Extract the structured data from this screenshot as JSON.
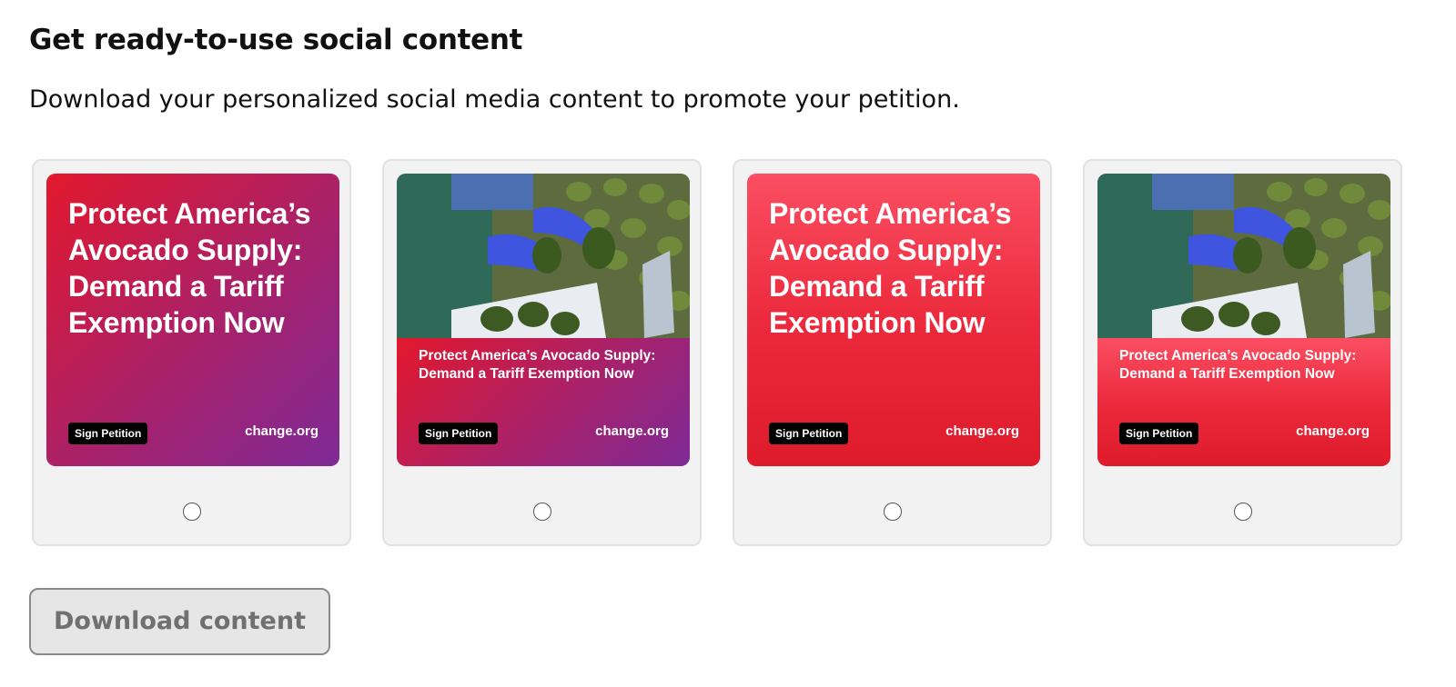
{
  "header": {
    "title": "Get ready-to-use social content",
    "description": "Download your personalized social media content to promote your petition."
  },
  "cards": [
    {
      "style": "text-only",
      "gradient": "purple",
      "title": "Protect America’s Avocado Supply: Demand a Tariff Exemption Now",
      "badge": "Sign Petition",
      "brand": "change.org",
      "selected": false
    },
    {
      "style": "photo",
      "gradient": "purple",
      "image": "gloved hands holding avocados",
      "title": "Protect America’s Avocado Supply: Demand a Tariff Exemption Now",
      "badge": "Sign Petition",
      "brand": "change.org",
      "selected": false
    },
    {
      "style": "text-only",
      "gradient": "red",
      "title": "Protect America’s Avocado Supply: Demand a Tariff Exemption Now",
      "badge": "Sign Petition",
      "brand": "change.org",
      "selected": false
    },
    {
      "style": "photo",
      "gradient": "red",
      "image": "gloved hands holding avocados",
      "title": "Protect America’s Avocado Supply: Demand a Tariff Exemption Now",
      "badge": "Sign Petition",
      "brand": "change.org",
      "selected": false
    }
  ],
  "actions": {
    "download_label": "Download content",
    "download_disabled": true
  },
  "colors": {
    "purple_gradient": [
      "#e3182d",
      "#a8216a",
      "#7e2a97"
    ],
    "red_gradient": [
      "#fb4e62",
      "#ec2a3d",
      "#de1b2b"
    ],
    "badge_bg": "#000000",
    "card_bg": "#f2f2f2",
    "button_disabled_bg": "#e6e6e6"
  }
}
